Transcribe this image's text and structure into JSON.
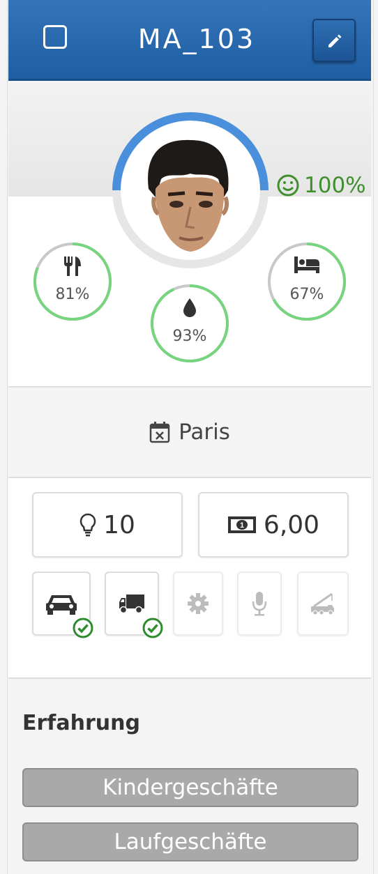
{
  "header": {
    "title": "MA_103"
  },
  "status": {
    "happiness": "100%"
  },
  "stats": [
    {
      "name": "food",
      "value": "81%",
      "fraction": 0.81
    },
    {
      "name": "drink",
      "value": "93%",
      "fraction": 0.93
    },
    {
      "name": "sleep",
      "value": "67%",
      "fraction": 0.67
    }
  ],
  "location": {
    "city": "Paris"
  },
  "values": {
    "ideas": "10",
    "money": "6,00"
  },
  "skills_section": {
    "title": "Erfahrung",
    "items": [
      "Kindergeschäfte",
      "Laufgeschäfte"
    ]
  },
  "colors": {
    "header": "#1e5ea3",
    "ring_green": "#76d37e",
    "ring_blue": "#4a8fdb",
    "happy_green": "#3f8f2e",
    "check_green": "#2e8b2e"
  },
  "icons": [
    "square-checkbox-icon",
    "pencil-icon",
    "smile-icon",
    "fork-knife-icon",
    "water-drop-icon",
    "bed-icon",
    "calendar-x-icon",
    "lightbulb-icon",
    "money-bill-icon",
    "car-icon",
    "truck-icon",
    "gear-icon",
    "microphone-icon",
    "crane-truck-icon",
    "check-circle-icon"
  ]
}
